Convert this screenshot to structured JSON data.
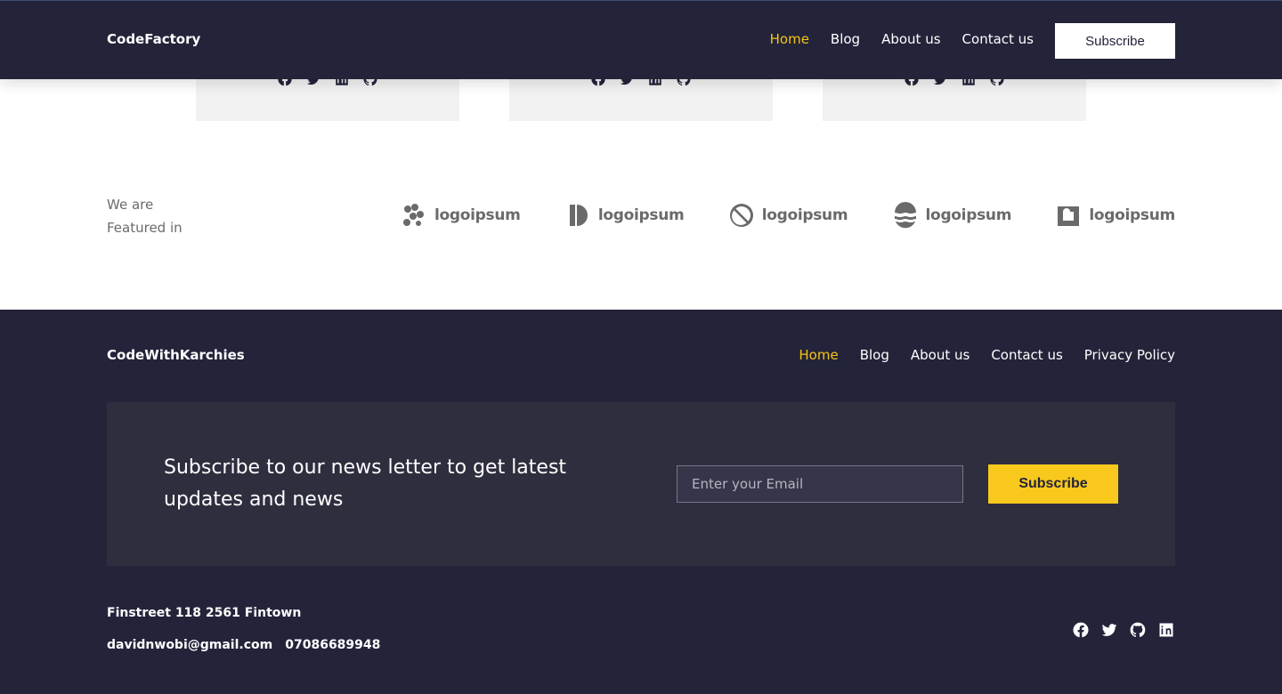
{
  "topnav": {
    "brand": "CodeFactory",
    "links": [
      "Home",
      "Blog",
      "About us",
      "Contact us"
    ],
    "subscribe_label": "Subscribe"
  },
  "featured": {
    "label_line1": "We are",
    "label_line2": "Featured in",
    "logos": [
      "logoipsum",
      "logoipsum",
      "logoipsum",
      "logoipsum",
      "logoipsum"
    ]
  },
  "footer": {
    "brand": "CodeWithKarchies",
    "links": [
      "Home",
      "Blog",
      "About us",
      "Contact us",
      "Privacy Policy"
    ],
    "newsletter": {
      "headline": "Subscribe to our news letter to get latest updates and news",
      "email_placeholder": "Enter your Email",
      "button_label": "Subscribe"
    },
    "address": "Finstreet 118 2561 Fintown",
    "email": "davidnwobi@gmail.com",
    "phone": "07086689948",
    "social_icons": [
      "facebook-icon",
      "twitter-icon",
      "github-icon",
      "linkedin-icon"
    ]
  },
  "colors": {
    "dark": "#23233a",
    "accent": "#f5c518",
    "panel": "#2e2e3f"
  }
}
